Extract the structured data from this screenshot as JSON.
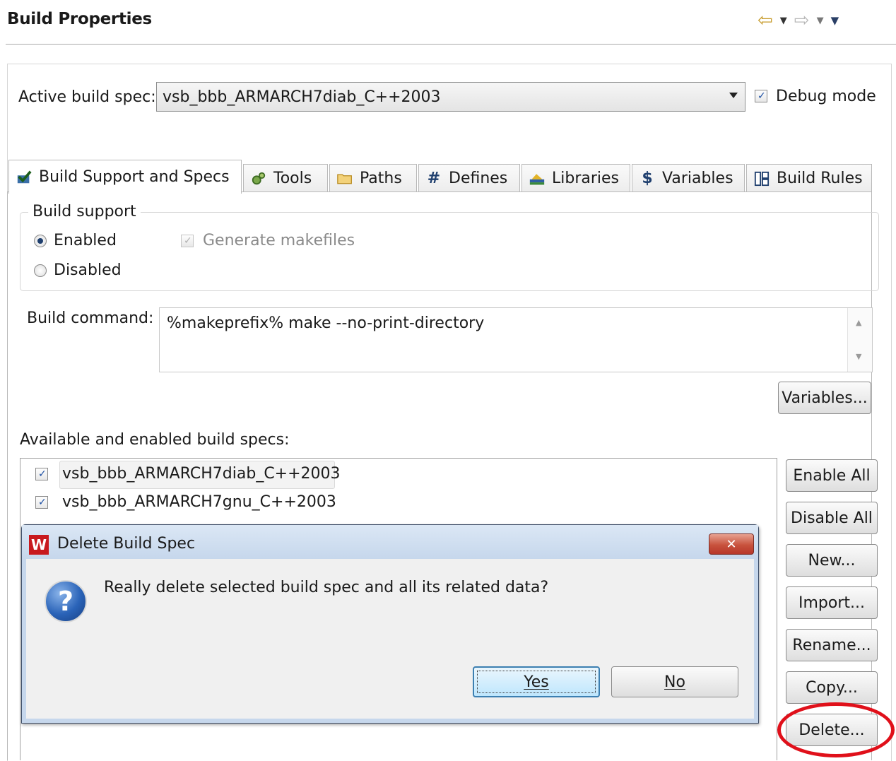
{
  "header": {
    "title": "Build Properties",
    "nav": {
      "back_icon": "⇦",
      "dropdown_icon": "▼",
      "forward_icon": "⇨",
      "menu_icon": "▼"
    }
  },
  "active_build_spec": {
    "label": "Active build spec:",
    "value": "vsb_bbb_ARMARCH7diab_C++2003",
    "debug_mode": {
      "label": "Debug mode",
      "checked": true
    }
  },
  "tabs": [
    {
      "label": "Build Support and Specs",
      "icon": "check-build-icon",
      "active": true
    },
    {
      "label": "Tools",
      "icon": "gears-icon"
    },
    {
      "label": "Paths",
      "icon": "folder-icon"
    },
    {
      "label": "Defines",
      "icon": "hash-icon"
    },
    {
      "label": "Libraries",
      "icon": "books-icon"
    },
    {
      "label": "Variables",
      "icon": "dollar-icon"
    },
    {
      "label": "Build Rules",
      "icon": "build-rules-icon"
    }
  ],
  "build_support": {
    "legend": "Build support",
    "enabled_label": "Enabled",
    "disabled_label": "Disabled",
    "selected": "Enabled",
    "generate_makefiles": {
      "label": "Generate makefiles",
      "checked": true,
      "disabled": true
    }
  },
  "build_command": {
    "label": "Build command:",
    "value": "%makeprefix% make --no-print-directory",
    "variables_button": "Variables..."
  },
  "specs": {
    "label": "Available and enabled build specs:",
    "items": [
      {
        "name": "vsb_bbb_ARMARCH7diab_C++2003",
        "checked": true,
        "selected": true
      },
      {
        "name": "vsb_bbb_ARMARCH7gnu_C++2003",
        "checked": true
      }
    ],
    "buttons": {
      "enable_all": "Enable All",
      "disable_all": "Disable All",
      "new": "New...",
      "import": "Import...",
      "rename": "Rename...",
      "copy": "Copy...",
      "delete": "Delete..."
    }
  },
  "dialog": {
    "logo": "W",
    "title": "Delete Build Spec",
    "close_glyph": "✕",
    "message": "Really delete selected build spec and all its related data?",
    "question_glyph": "?",
    "yes_label": "Yes",
    "no_label": "No"
  },
  "colors": {
    "highlight_ring": "#e0101a",
    "dialog_titlebar": "#c6d7ec",
    "close_button": "#c8523d",
    "logo_red": "#c8191e"
  }
}
